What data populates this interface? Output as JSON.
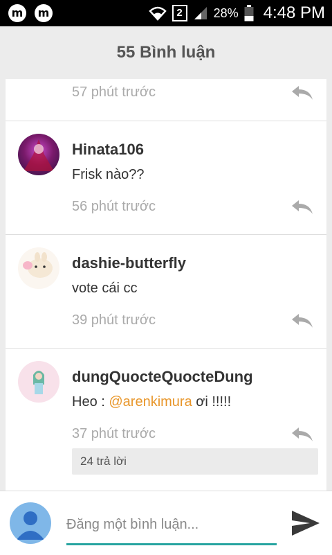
{
  "status": {
    "battery": "28%",
    "time": "4:48 PM",
    "sim": "2",
    "app_icon": "m"
  },
  "header": {
    "title": "55 Bình luận"
  },
  "comments": [
    {
      "time": "57 phút trước"
    },
    {
      "user": "Hinata106",
      "text": "Frisk nào??",
      "time": "56 phút trước"
    },
    {
      "user": "dashie-butterfly",
      "text": "vote cái cc",
      "time": "39 phút trước"
    },
    {
      "user": "dungQuocteQuocteDung",
      "text_prefix": "Heo : ",
      "mention": "@arenkimura",
      "text_suffix": " ơi !!!!!",
      "time": "37 phút trước",
      "replies": "24 trả lời"
    }
  ],
  "composer": {
    "placeholder": "Đăng một bình luận..."
  },
  "colors": {
    "accent": "#27a4a0",
    "mention": "#e8962a"
  }
}
